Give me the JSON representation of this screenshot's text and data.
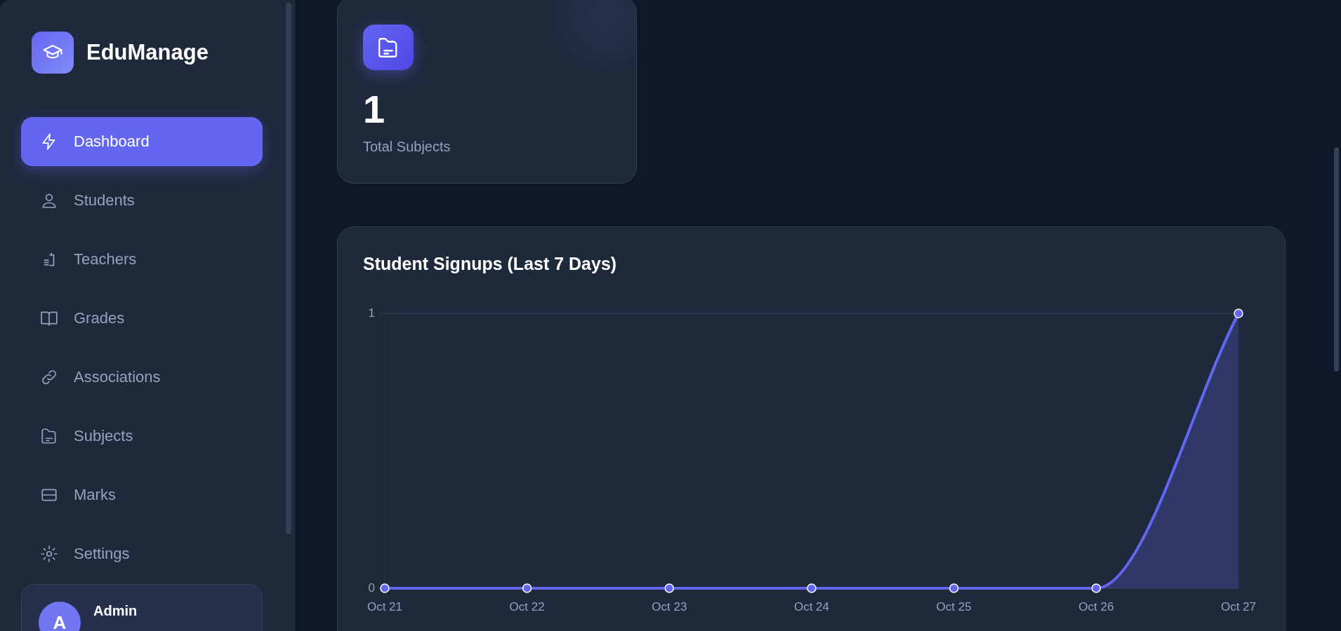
{
  "brand": {
    "name": "EduManage"
  },
  "nav": [
    {
      "label": "Dashboard",
      "selected": true
    },
    {
      "label": "Students",
      "selected": false
    },
    {
      "label": "Teachers",
      "selected": false
    },
    {
      "label": "Grades",
      "selected": false
    },
    {
      "label": "Associations",
      "selected": false
    },
    {
      "label": "Subjects",
      "selected": false
    },
    {
      "label": "Marks",
      "selected": false
    },
    {
      "label": "Settings",
      "selected": false
    }
  ],
  "user": {
    "avatar": "A",
    "name": "Admin"
  },
  "stat_card": {
    "value": "1",
    "label": "Total Subjects"
  },
  "chart_card": {
    "title": "Student Signups (Last 7 Days)",
    "chart_data": {
      "type": "area",
      "categories": [
        "Oct 21",
        "Oct 22",
        "Oct 23",
        "Oct 24",
        "Oct 25",
        "Oct 26",
        "Oct 27"
      ],
      "series": [
        {
          "color": "#6366f1",
          "marker": true,
          "values": [
            0,
            0,
            0,
            0,
            0,
            0,
            1
          ]
        }
      ],
      "ylim": [
        0,
        1
      ],
      "yticks": [
        0,
        1
      ]
    }
  }
}
